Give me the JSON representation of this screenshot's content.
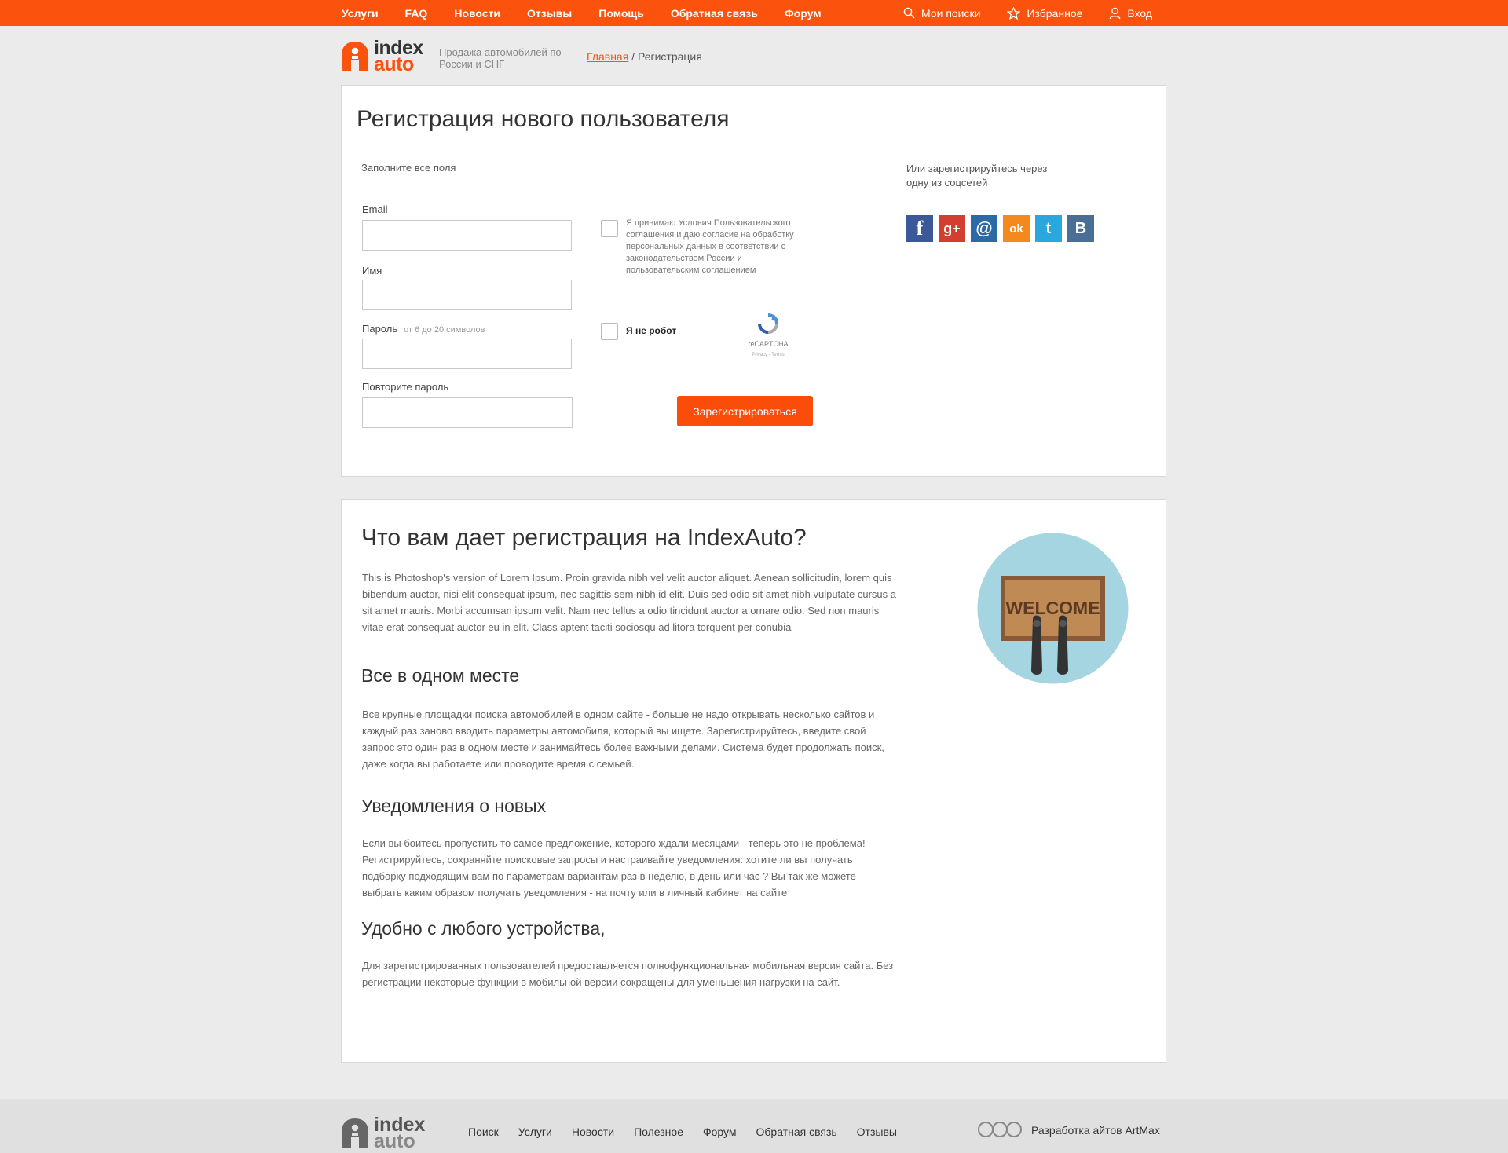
{
  "topnav": {
    "items": [
      "Услуги",
      "FAQ",
      "Новости",
      "Отзывы",
      "Помощь",
      "Обратная  связь",
      "Форум"
    ],
    "my_searches": "Мои поиски",
    "favorites": "Избранное",
    "login": "Вход"
  },
  "header": {
    "logo_word1": "index",
    "logo_word2": "auto",
    "tagline": "Продажа автомобилей по России и СНГ",
    "breadcrumb_home": "Главная",
    "breadcrumb_sep": " / ",
    "breadcrumb_current": "Регистрация"
  },
  "form": {
    "title": "Регистрация нового пользователя",
    "fill_all": "Заполните все поля",
    "email_label": "Email",
    "name_label": "Имя",
    "password_label": "Пароль",
    "password_hint": "от 6 до 20 символов",
    "repeat_password_label": "Повторите пароль",
    "agreement_text": "Я принимаю Условия Пользовательского соглашения и даю согласие на обработку персональных данных в соответствии с законодательством России и пользовательским соглашением",
    "captcha_label": "Я не робот",
    "captcha_brand": "reCAPTCHA",
    "captcha_links": "Privacy - Terms",
    "submit": "Зарегистрироваться",
    "social_title": "Или зарегистрируйтесь через одну из соцсетей",
    "socials": [
      {
        "name": "facebook",
        "glyph": "f",
        "color": "#3b5998"
      },
      {
        "name": "google-plus",
        "glyph": "g+",
        "color": "#d23f31"
      },
      {
        "name": "mail",
        "glyph": "@",
        "color": "#2b6aa7"
      },
      {
        "name": "odnoklassniki",
        "glyph": "ok",
        "color": "#f4891e"
      },
      {
        "name": "twitter",
        "glyph": "t",
        "color": "#2ba7e0"
      },
      {
        "name": "vkontakte",
        "glyph": "B",
        "color": "#4a6e96"
      }
    ]
  },
  "benefits": {
    "title": "Что вам дает регистрация на IndexAuto?",
    "intro": "This is Photoshop's version  of Lorem Ipsum. Proin gravida nibh vel velit auctor aliquet. Aenean sollicitudin, lorem quis bibendum auctor, nisi elit consequat ipsum, nec sagittis sem nibh id elit. Duis sed odio sit amet nibh vulputate cursus a sit amet mauris. Morbi accumsan ipsum velit. Nam nec tellus a odio tincidunt auctor a ornare odio. Sed non  mauris vitae erat consequat auctor eu in elit. Class aptent taciti sociosqu ad litora torquent per conubia",
    "sections": [
      {
        "heading": "Все в одном месте",
        "text": "Все крупные площадки поиска автомобилей в одном сайте - больше не надо открывать несколько сайтов и каждый раз заново вводить параметры автомобиля, который вы ищете. Зарегистрируйтесь, введите свой запрос это один раз в одном месте и занимайтесь более важными делами. Система будет продолжать поиск, даже когда вы работаете или проводите время с семьей."
      },
      {
        "heading": "Уведомления о новых",
        "text": "Если вы боитесь пропустить то самое предложение, которого ждали месяцами - теперь это не проблема! Регистрируйтесь, сохраняйте поисковые запросы и настраивайте уведомления: хотите ли вы получать подборку подходящим вам по параметрам вариантам раз в неделю, в день или час ? Вы так же можете выбрать каким образом получать уведомления - на почту или в личный кабинет на сайте"
      },
      {
        "heading": "Удобно с любого устройства,",
        "text": "Для зарегистрированных пользователей предоставляется полнофункциональная мобильная версия сайта. Без регистрации некоторые функции в мобильной версии сокращены для уменьшения нагрузки на сайт."
      }
    ],
    "welcome_text": "WELCOME"
  },
  "footer": {
    "logo_word1": "index",
    "logo_word2": "auto",
    "nav": [
      "Поиск",
      "Услуги",
      "Новости",
      "Полезное",
      "Форум",
      "Обратная  связь",
      "Отзывы"
    ],
    "developer": "Разработка айтов ArtMax"
  }
}
